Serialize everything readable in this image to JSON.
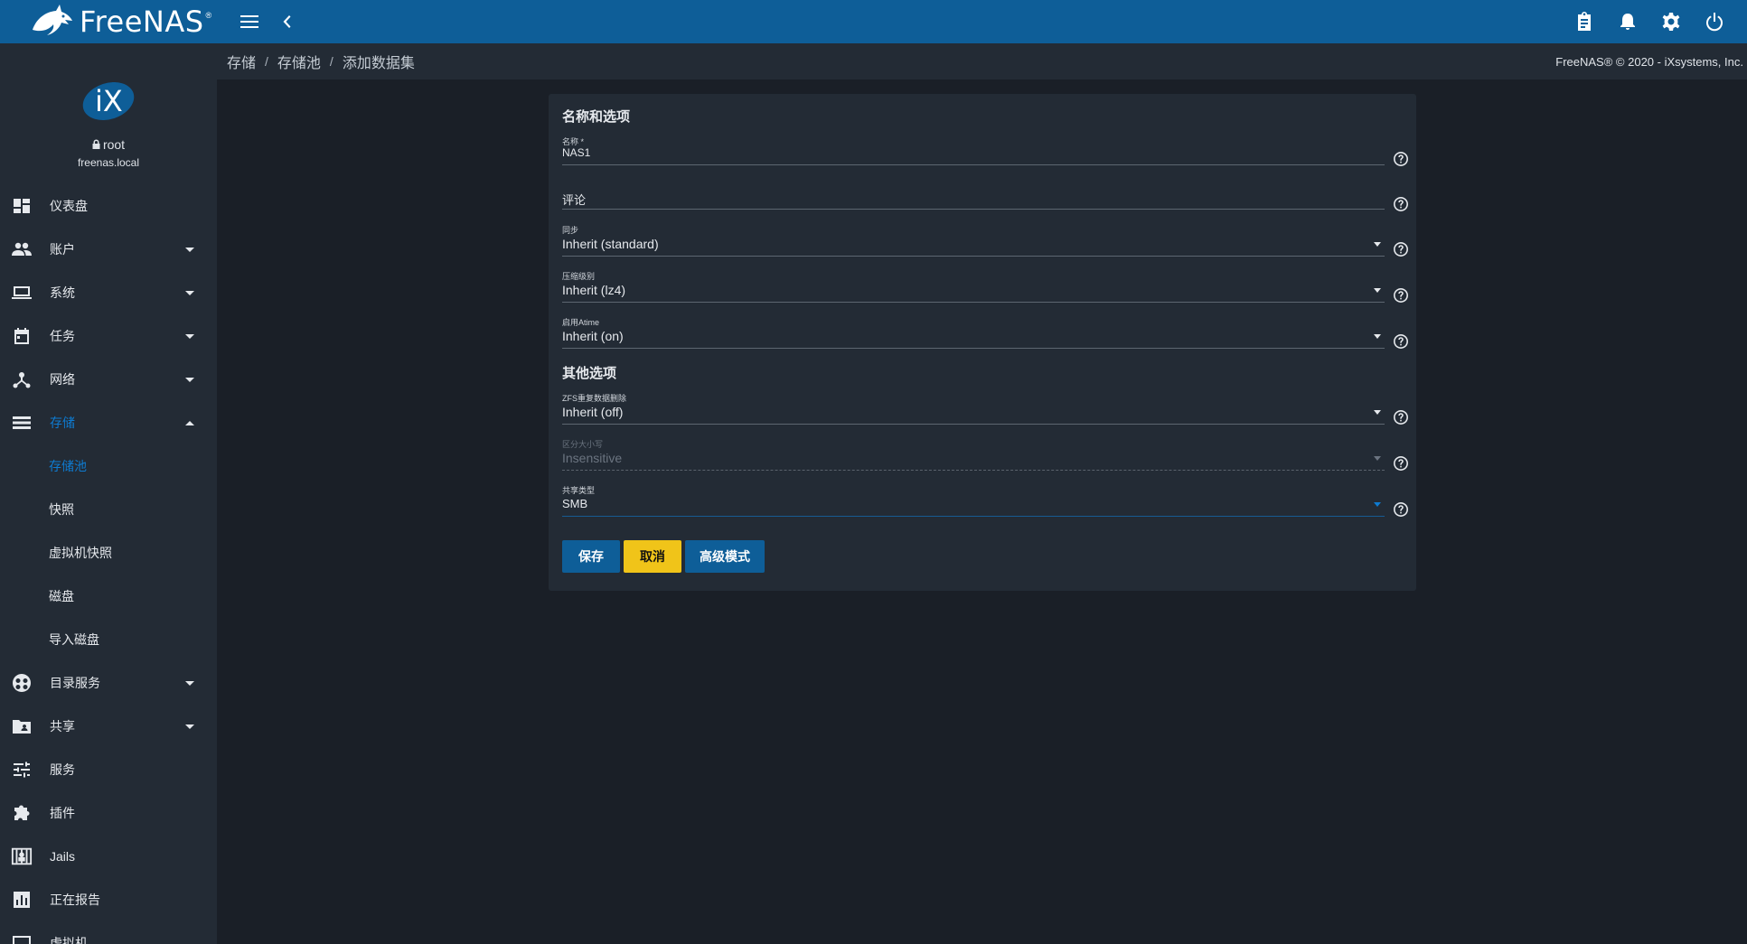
{
  "app": {
    "brand": "FreeNAS",
    "brand_mark": "®"
  },
  "topbar": {
    "icons": [
      "menu-icon",
      "chevron-left-icon",
      "clipboard-icon",
      "bell-icon",
      "gear-icon",
      "power-icon"
    ]
  },
  "sidebar": {
    "user": "root",
    "host": "freenas.local",
    "items": [
      {
        "label": "仪表盘",
        "icon": "dashboard-icon"
      },
      {
        "label": "账户",
        "icon": "people-icon",
        "expandable": true
      },
      {
        "label": "系统",
        "icon": "laptop-icon",
        "expandable": true
      },
      {
        "label": "任务",
        "icon": "calendar-icon",
        "expandable": true
      },
      {
        "label": "网络",
        "icon": "network-icon",
        "expandable": true
      },
      {
        "label": "存储",
        "icon": "storage-icon",
        "expandable": true,
        "expanded": true,
        "active": true
      },
      {
        "label": "存储池",
        "sub": true,
        "active": true
      },
      {
        "label": "快照",
        "sub": true
      },
      {
        "label": "虚拟机快照",
        "sub": true
      },
      {
        "label": "磁盘",
        "sub": true
      },
      {
        "label": "导入磁盘",
        "sub": true
      },
      {
        "label": "目录服务",
        "icon": "directory-icon",
        "expandable": true
      },
      {
        "label": "共享",
        "icon": "share-folder-icon",
        "expandable": true
      },
      {
        "label": "服务",
        "icon": "tune-icon"
      },
      {
        "label": "插件",
        "icon": "puzzle-icon"
      },
      {
        "label": "Jails",
        "icon": "jail-icon"
      },
      {
        "label": "正在报告",
        "icon": "chart-icon"
      },
      {
        "label": "虚拟机",
        "icon": "monitor-icon"
      }
    ]
  },
  "breadcrumb": {
    "items": [
      "存储",
      "存储池",
      "添加数据集"
    ],
    "separator": "/"
  },
  "copyright": "FreeNAS® © 2020 - iXsystems, Inc.",
  "form": {
    "section1_title": "名称和选项",
    "section2_title": "其他选项",
    "fields": {
      "name": {
        "label": "名称 *",
        "value": "NAS1"
      },
      "comment": {
        "label": "评论",
        "value": ""
      },
      "sync": {
        "label": "同步",
        "value": "Inherit (standard)"
      },
      "compression": {
        "label": "压缩级别",
        "value": "Inherit (lz4)"
      },
      "atime": {
        "label": "启用Atime",
        "value": "Inherit (on)"
      },
      "dedup": {
        "label": "ZFS重复数据删除",
        "value": "Inherit (off)"
      },
      "case": {
        "label": "区分大小写",
        "value": "Insensitive",
        "disabled": true
      },
      "share_type": {
        "label": "共享类型",
        "value": "SMB"
      }
    },
    "buttons": {
      "save": "保存",
      "cancel": "取消",
      "advanced": "高级模式"
    }
  },
  "colors": {
    "topbar": "#0e5e98",
    "sidebar": "#232b35",
    "background": "#1a1f27",
    "accent": "#0e7bd1",
    "cancel_button": "#f0c419"
  }
}
